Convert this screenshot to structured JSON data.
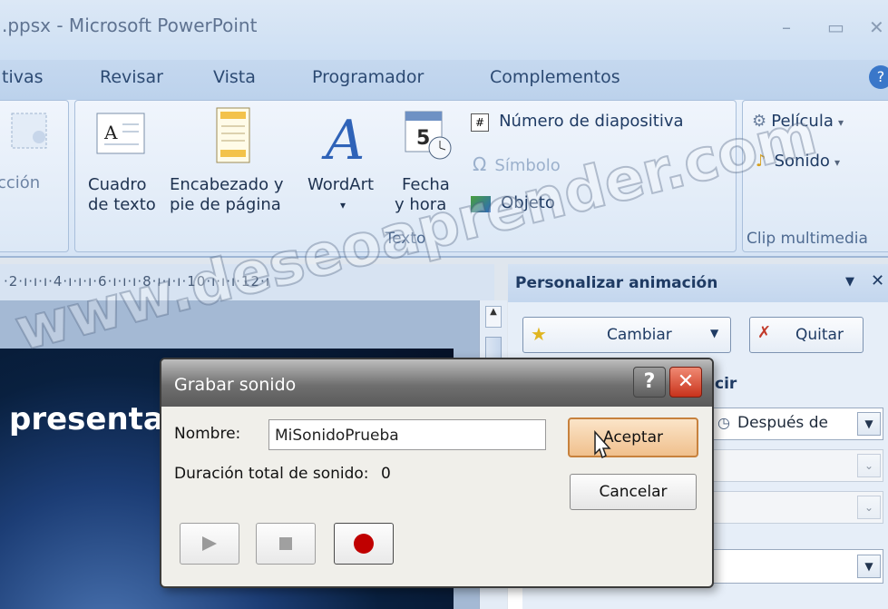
{
  "window": {
    "title": ".ppsx - Microsoft PowerPoint"
  },
  "tabs": [
    "tivas",
    "Revisar",
    "Vista",
    "Programador",
    "Complementos"
  ],
  "ribbon": {
    "partial_group_label": "cción",
    "text_group": {
      "label": "Texto",
      "cuadro": [
        "Cuadro",
        "de texto"
      ],
      "encabezado": [
        "Encabezado y",
        "pie de página"
      ],
      "wordart": "WordArt",
      "fecha": [
        "Fecha",
        "y hora"
      ],
      "numero": "Número de diapositiva",
      "simbolo": "Símbolo",
      "objeto": "Objeto"
    },
    "media_group": {
      "label": "Clip multimedia",
      "pelicula": "Película",
      "sonido": "Sonido"
    }
  },
  "ruler": {
    "ticks": "·2·ı·ı·ı·4·ı·ı·ı·6·ı·ı·ı·8·ı·ı·ı·10·ı·ı·ı·12·ı"
  },
  "slide": {
    "text": "presentac"
  },
  "taskpane": {
    "title": "Personalizar animación",
    "change_label": "Cambiar",
    "remove_label": "Quitar",
    "tab_partial": "cir",
    "after_label": "Después de"
  },
  "dialog": {
    "title": "Grabar sonido",
    "name_label": "Nombre:",
    "name_value": "MiSonidoPrueba",
    "duration_label": "Duración total de sonido:",
    "duration_value": "0",
    "ok_label": "Aceptar",
    "cancel_label": "Cancelar"
  },
  "watermark": "www.deseoaprender.com",
  "colors": {
    "record": "#c00000",
    "close": "#d9472b",
    "accent_text": "#1f3b64"
  }
}
